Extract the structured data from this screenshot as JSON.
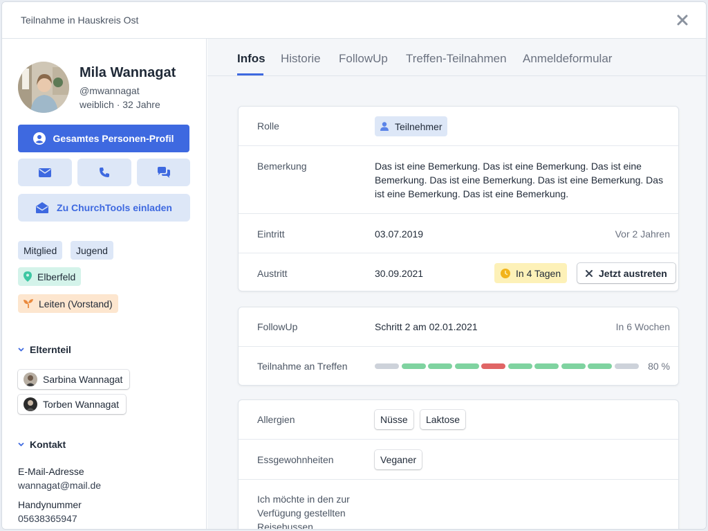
{
  "dialog": {
    "title": "Teilnahme in Hauskreis Ost"
  },
  "profile": {
    "name": "Mila Wannagat",
    "handle": "@mwannagat",
    "meta": "weiblich · 32 Jahre",
    "profile_button": "Gesamtes Personen-Profil",
    "invite_button": "Zu ChurchTools einladen",
    "tags": [
      "Mitglied",
      "Jugend"
    ],
    "location": "Elberfeld",
    "role_tag": "Leiten (Vorstand)"
  },
  "parents": {
    "heading": "Elternteil",
    "items": [
      {
        "name": "Sarbina Wannagat"
      },
      {
        "name": "Torben Wannagat"
      }
    ]
  },
  "contact": {
    "heading": "Kontakt",
    "email_label": "E-Mail-Adresse",
    "email": "wannagat@mail.de",
    "phone_label": "Handynummer",
    "phone": "05638365947"
  },
  "tabs": [
    "Infos",
    "Historie",
    "FollowUp",
    "Treffen-Teilnahmen",
    "Anmeldeformular"
  ],
  "active_tab": "Infos",
  "info": {
    "role_label": "Rolle",
    "role_value": "Teilnehmer",
    "remark_label": "Bemerkung",
    "remark_lines": [
      "Das ist eine Bemerkung. Das ist eine Bemerkung. Das ist eine",
      "Bemerkung. Das ist eine Bemerkung. Das ist eine Bemerkung. Das",
      "ist eine Bemerkung. Das ist eine Bemerkung."
    ],
    "entry_label": "Eintritt",
    "entry_date": "03.07.2019",
    "entry_relative": "Vor 2 Jahren",
    "exit_label": "Austritt",
    "exit_date": "30.09.2021",
    "exit_badge": "In 4 Tagen",
    "exit_button": "Jetzt austreten"
  },
  "followup": {
    "label": "FollowUp",
    "value": "Schritt 2 am 02.01.2021",
    "relative": "In 6 Wochen",
    "attendance_label": "Teilnahme an Treffen",
    "attendance_percent": "80 %",
    "attendance_segments": [
      "none",
      "attended",
      "attended",
      "attended",
      "missed",
      "attended",
      "attended",
      "attended",
      "attended",
      "none"
    ]
  },
  "details": {
    "allergies_label": "Allergien",
    "allergies": [
      "Nüsse",
      "Laktose"
    ],
    "diet_label": "Essgewohnheiten",
    "diet": [
      "Veganer"
    ],
    "bus_label_lines": [
      "Ich möchte in den zur",
      "Verfügung gestellten",
      "Reisebussen"
    ]
  },
  "colors": {
    "accent": "#3e69e0",
    "attended": "#7fd3a0",
    "missed": "#e06565",
    "none": "#cdd2da"
  }
}
